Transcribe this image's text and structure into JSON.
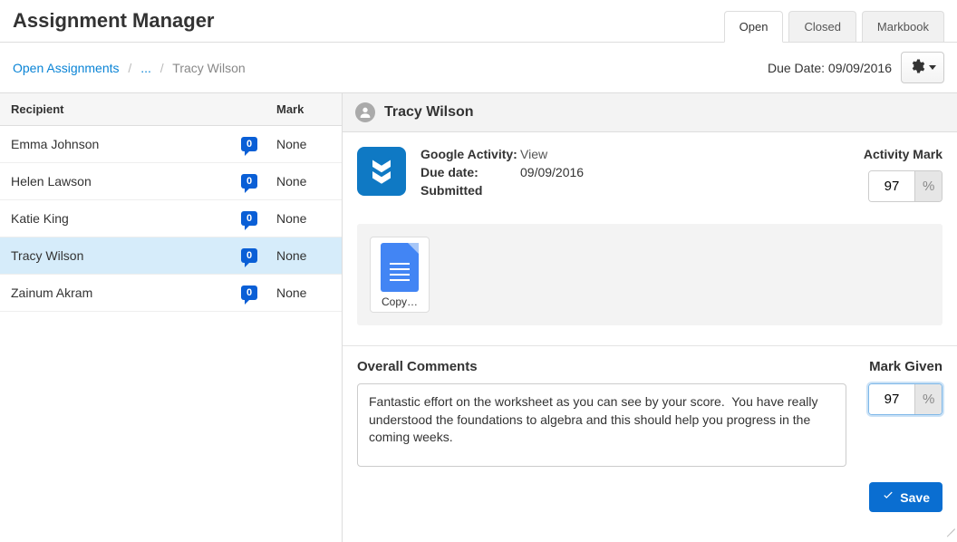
{
  "header": {
    "title": "Assignment Manager",
    "tabs": [
      {
        "label": "Open",
        "active": true
      },
      {
        "label": "Closed",
        "active": false
      },
      {
        "label": "Markbook",
        "active": false
      }
    ]
  },
  "breadcrumb": {
    "root": "Open Assignments",
    "mid": "...",
    "current": "Tracy Wilson"
  },
  "due_label": "Due Date:",
  "due_value": "09/09/2016",
  "table": {
    "col_recipient": "Recipient",
    "col_mark": "Mark",
    "rows": [
      {
        "name": "Emma Johnson",
        "badge": "0",
        "mark": "None",
        "selected": false
      },
      {
        "name": "Helen Lawson",
        "badge": "0",
        "mark": "None",
        "selected": false
      },
      {
        "name": "Katie King",
        "badge": "0",
        "mark": "None",
        "selected": false
      },
      {
        "name": "Tracy Wilson",
        "badge": "0",
        "mark": "None",
        "selected": true
      },
      {
        "name": "Zainum Akram",
        "badge": "0",
        "mark": "None",
        "selected": false
      }
    ]
  },
  "student": {
    "name": "Tracy Wilson",
    "activity_label": "Google Activity:",
    "activity_view": "View",
    "duedate_label": "Due date:",
    "duedate_value": "09/09/2016",
    "status": "Submitted",
    "activity_mark_label": "Activity Mark",
    "activity_mark_value": "97",
    "percent": "%",
    "doc_name": "Copy…"
  },
  "comments": {
    "header": "Overall Comments",
    "text": "Fantastic effort on the worksheet as you can see by your score.  You have really understood the foundations to algebra and this should help you progress in the coming weeks.",
    "mark_given_label": "Mark Given",
    "mark_given_value": "97",
    "percent": "%"
  },
  "save_label": "Save"
}
